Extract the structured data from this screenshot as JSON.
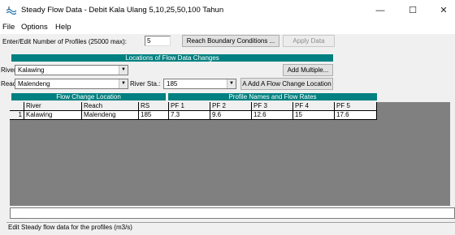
{
  "window": {
    "title": "Steady Flow Data - Debit Kala Ulang 5,10,25,50,100 Tahun",
    "minimize_glyph": "—",
    "maximize_glyph": "☐",
    "close_glyph": "✕"
  },
  "menu": {
    "file": "File",
    "options": "Options",
    "help": "Help"
  },
  "profiles": {
    "label": "Enter/Edit Number of Profiles (25000 max):",
    "value": "5",
    "reach_boundary_button": "Reach Boundary Conditions ...",
    "apply_data_button": "Apply Data"
  },
  "locations": {
    "section_title": "Locations of Flow Data Changes",
    "river_label": "River:",
    "river_value": "Kalawing",
    "add_multiple_button": "Add Multiple...",
    "reach_label": "Reach:",
    "reach_value": "Malendeng",
    "river_sta_label": "River Sta.:",
    "river_sta_value": "185",
    "add_flow_change_button": "A Add A Flow Change Location"
  },
  "table": {
    "flow_change_title": "Flow Change Location",
    "profile_names_title": "Profile Names and Flow Rates",
    "headers": [
      "River",
      "Reach",
      "RS",
      "PF 1",
      "PF 2",
      "PF 3",
      "PF 4",
      "PF 5"
    ],
    "rows": [
      {
        "num": "1",
        "cells": [
          "Kalawing",
          "Malendeng",
          "185",
          "7.3",
          "9.6",
          "12.6",
          "15",
          "17.6"
        ]
      }
    ]
  },
  "status": {
    "text": "Edit Steady flow data for the profiles (m3/s)"
  }
}
